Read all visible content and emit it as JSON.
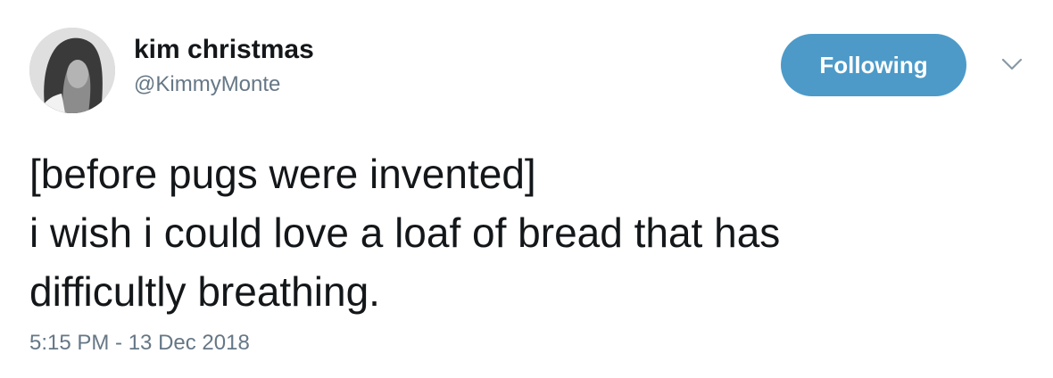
{
  "author": {
    "display_name": "kim christmas",
    "handle": "@KimmyMonte"
  },
  "follow_button": {
    "label": "Following",
    "color": "#4d9ac8"
  },
  "menu": {
    "icon": "chevron-down-icon"
  },
  "tweet": {
    "lines": [
      "[before pugs were invented]",
      "i wish i could love a loaf of bread that has",
      "difficultly breathing."
    ],
    "timestamp": "5:15 PM - 13 Dec 2018"
  },
  "colors": {
    "text": "#14171a",
    "muted": "#657786",
    "background": "#ffffff"
  }
}
